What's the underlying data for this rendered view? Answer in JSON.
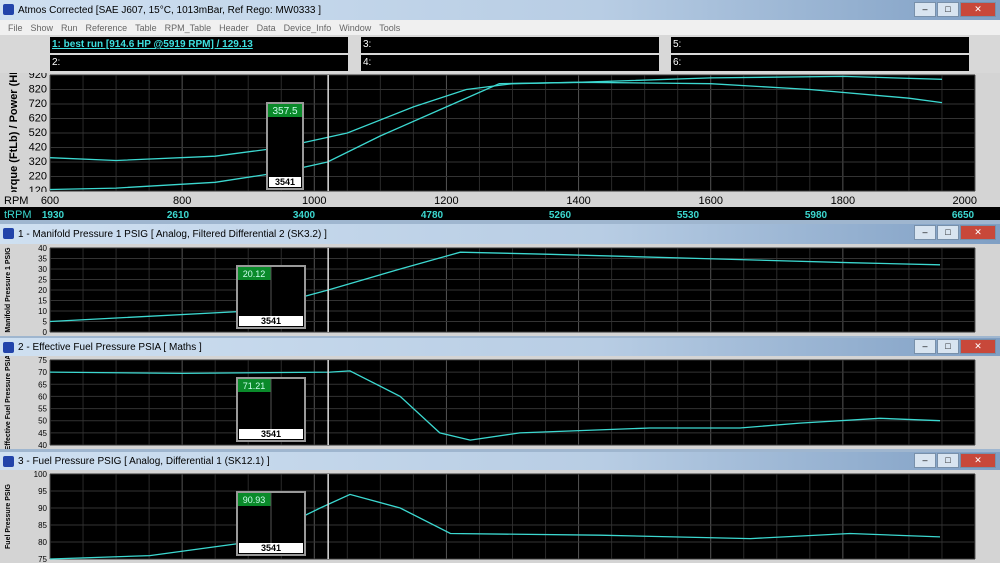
{
  "window": {
    "title": "Atmos Corrected [SAE J607, 15°C, 1013mBar,  Ref Rego: MW0333 ]"
  },
  "menu": [
    "File",
    "Show",
    "Run",
    "Reference",
    "Table",
    "RPM_Table",
    "Header",
    "Data",
    "Device_Info",
    "Window",
    "Tools"
  ],
  "runs": [
    {
      "label": "1:     best run [914.6 HP @5919 RPM] / 129.13",
      "active": true
    },
    {
      "label": "2:"
    },
    {
      "label": "3:"
    },
    {
      "label": "4:"
    },
    {
      "label": "5:"
    },
    {
      "label": "6:"
    }
  ],
  "colors": {
    "trace": "#3cd8d0",
    "cursor_value_bg": "#0a8a2a",
    "plot_bg": "#000000"
  },
  "cursor": {
    "rpm_readout": "3541"
  },
  "trpm": {
    "label": "tRPM",
    "values": [
      "1930",
      "2610",
      "3400",
      "4780",
      "5260",
      "5530",
      "5980",
      "6650"
    ]
  },
  "chart_data": [
    {
      "type": "line",
      "ylabel": "Torque (FtLb) / Power (HP)",
      "xlabel": "RPM",
      "xlim": [
        600,
        2000
      ],
      "ylim": [
        120,
        920
      ],
      "xticks": [
        "600",
        "800",
        "1000",
        "1200",
        "1400",
        "1600",
        "1800",
        "2000"
      ],
      "yticks": [
        "120",
        "220",
        "320",
        "420",
        "520",
        "620",
        "720",
        "820",
        "920"
      ],
      "cursor_value": "357.5",
      "cursor_x": 1021,
      "series": [
        {
          "x": [
            600,
            700,
            850,
            950,
            1050,
            1150,
            1230,
            1300,
            1400,
            1600,
            1750,
            1900,
            1950
          ],
          "y": [
            350,
            330,
            360,
            420,
            520,
            700,
            820,
            860,
            870,
            860,
            820,
            760,
            730
          ]
        },
        {
          "x": [
            600,
            700,
            850,
            950,
            1020,
            1100,
            1200,
            1280,
            1400,
            1600,
            1800,
            1950
          ],
          "y": [
            130,
            140,
            180,
            250,
            320,
            500,
            700,
            860,
            870,
            900,
            910,
            890
          ]
        }
      ]
    },
    {
      "type": "line",
      "panel_title": "1 - Manifold Pressure 1 PSIG    [ Analog, Filtered Differential 2 (SK3.2) ]",
      "ylabel": "Manifold Pressure 1 PSIG",
      "ylim": [
        0,
        40
      ],
      "yticks": [
        "0",
        "5",
        "10",
        "15",
        "20",
        "25",
        "30",
        "35",
        "40"
      ],
      "cursor_value": "20.12",
      "cursor_x": 1021,
      "series": [
        {
          "x": [
            600,
            903,
            1021,
            1130,
            1221,
            1357,
            1584,
            1811,
            1947
          ],
          "y": [
            5,
            10,
            20,
            30,
            38,
            37,
            35,
            33,
            32
          ]
        }
      ]
    },
    {
      "type": "line",
      "panel_title": "2 - Effective Fuel Pressure PSIA     [ Maths ]",
      "ylabel": "Effective Fuel Pressure PSIA",
      "ylim": [
        40,
        75
      ],
      "yticks": [
        "40",
        "45",
        "50",
        "55",
        "60",
        "65",
        "70",
        "75"
      ],
      "cursor_value": "71.21",
      "cursor_x": 1021,
      "series": [
        {
          "x": [
            600,
            800,
            1024,
            1054,
            1130,
            1190,
            1236,
            1311,
            1508,
            1644,
            1735,
            1856,
            1947
          ],
          "y": [
            70,
            69.5,
            70,
            70.5,
            60,
            45,
            42,
            45,
            47,
            47,
            49,
            51,
            50
          ]
        }
      ]
    },
    {
      "type": "line",
      "panel_title": "3 - Fuel Pressure PSIG     [ Analog, Differential 1 (SK12.1) ]",
      "ylabel": "Fuel Pressure PSIG",
      "ylim": [
        75,
        100
      ],
      "yticks": [
        "75",
        "80",
        "85",
        "90",
        "95",
        "100"
      ],
      "cursor_value": "90.93",
      "cursor_x": 1021,
      "series": [
        {
          "x": [
            600,
            751,
            903,
            1009,
            1054,
            1130,
            1206,
            1433,
            1660,
            1811,
            1947
          ],
          "y": [
            75,
            76,
            80,
            90,
            94,
            90,
            82.5,
            82,
            81,
            82.5,
            81.5
          ]
        }
      ]
    }
  ]
}
